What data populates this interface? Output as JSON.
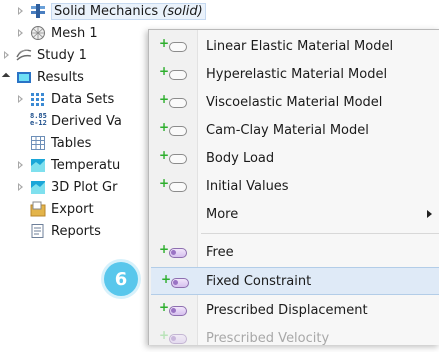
{
  "tree": {
    "items": [
      {
        "label": "Solid Mechanics ",
        "label_suffix": "(solid)",
        "icon": "solid-mechanics-icon"
      },
      {
        "label": "Mesh 1",
        "icon": "mesh-icon"
      },
      {
        "label": "Study 1",
        "icon": "study-icon"
      },
      {
        "label": "Results",
        "icon": "results-folder-icon"
      },
      {
        "label": "Data Sets",
        "icon": "data-sets-icon"
      },
      {
        "label": "Derived Va",
        "icon": "derived-values-icon",
        "icon_text": "8.85\ne-12"
      },
      {
        "label": "Tables",
        "icon": "tables-icon"
      },
      {
        "label": "Temperatu",
        "icon": "plot-group-icon"
      },
      {
        "label": "3D Plot Gr",
        "icon": "plot-group-icon"
      },
      {
        "label": "Export",
        "icon": "export-icon"
      },
      {
        "label": "Reports",
        "icon": "reports-icon"
      }
    ],
    "step_badge": "6"
  },
  "context_menu": {
    "items": [
      {
        "label": "Linear Elastic Material Model",
        "icon": "add-domain-icon"
      },
      {
        "label": "Hyperelastic Material Model",
        "icon": "add-domain-icon"
      },
      {
        "label": "Viscoelastic Material Model",
        "icon": "add-domain-icon"
      },
      {
        "label": "Cam-Clay Material Model",
        "icon": "add-domain-icon"
      },
      {
        "label": "Body Load",
        "icon": "add-domain-icon"
      },
      {
        "label": "Initial Values",
        "icon": "add-domain-icon"
      },
      {
        "label": "More",
        "icon": "submenu-arrow-icon"
      },
      {
        "label": "Free",
        "icon": "add-boundary-icon"
      },
      {
        "label": "Fixed Constraint",
        "icon": "add-boundary-icon",
        "highlighted": true
      },
      {
        "label": "Prescribed Displacement",
        "icon": "add-boundary-icon"
      },
      {
        "label": "Prescribed Velocity",
        "icon": "add-boundary-icon",
        "disabled": true
      }
    ]
  },
  "colors": {
    "accent": "#59c7ec",
    "highlight": "#dfeaf7",
    "plus_green": "#2dae2d"
  }
}
